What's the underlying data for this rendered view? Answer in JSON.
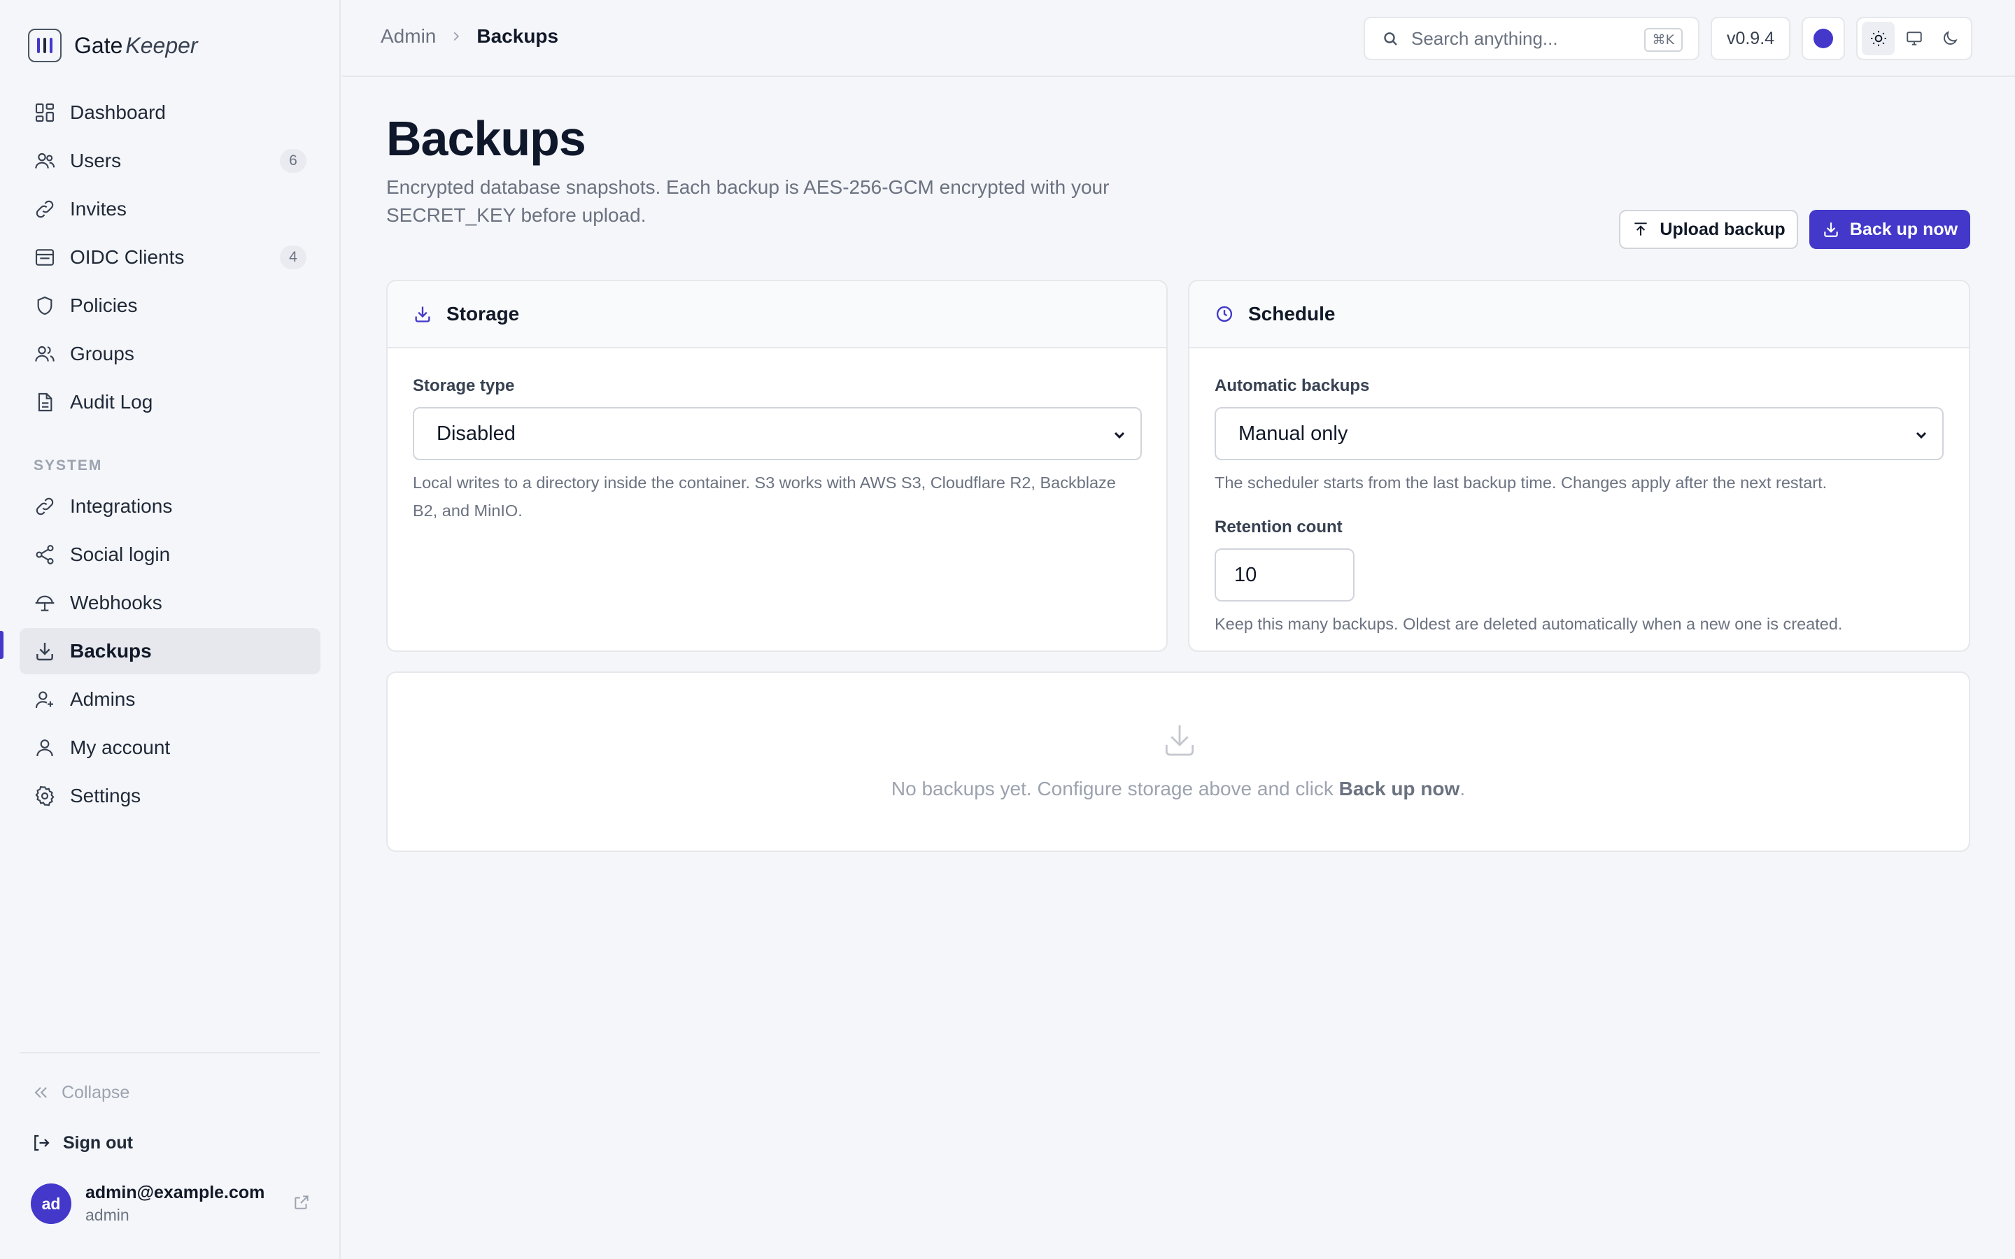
{
  "app": {
    "name_a": "Gate",
    "name_b": "Keeper"
  },
  "sidebar": {
    "items": [
      {
        "label": "Dashboard",
        "icon": "dashboard-icon"
      },
      {
        "label": "Users",
        "icon": "users-icon",
        "count": "6"
      },
      {
        "label": "Invites",
        "icon": "link-icon"
      },
      {
        "label": "OIDC Clients",
        "icon": "inbox-icon",
        "count": "4"
      },
      {
        "label": "Policies",
        "icon": "shield-icon"
      },
      {
        "label": "Groups",
        "icon": "groups-icon"
      },
      {
        "label": "Audit Log",
        "icon": "document-icon"
      }
    ],
    "section_label": "SYSTEM",
    "system_items": [
      {
        "label": "Integrations",
        "icon": "link-icon"
      },
      {
        "label": "Social login",
        "icon": "share-icon"
      },
      {
        "label": "Webhooks",
        "icon": "webhook-icon"
      },
      {
        "label": "Backups",
        "icon": "download-icon",
        "active": true
      },
      {
        "label": "Admins",
        "icon": "admin-icon"
      },
      {
        "label": "My account",
        "icon": "user-icon"
      },
      {
        "label": "Settings",
        "icon": "gear-icon"
      }
    ],
    "collapse_label": "Collapse",
    "signout_label": "Sign out",
    "user": {
      "initials": "ad",
      "email": "admin@example.com",
      "role": "admin"
    }
  },
  "topbar": {
    "breadcrumb": [
      "Admin",
      "Backups"
    ],
    "search_placeholder": "Search anything...",
    "search_shortcut": "⌘K",
    "version": "v0.9.4",
    "accent_color": "#4338ca",
    "theme_options": [
      "light",
      "system",
      "dark"
    ],
    "theme_selected": "light"
  },
  "main": {
    "title": "Backups",
    "description": "Encrypted database snapshots. Each backup is AES-256-GCM encrypted with your SECRET_KEY before upload.",
    "upload_button": "Upload backup",
    "backup_button": "Back up now",
    "storage": {
      "title": "Storage",
      "type_label": "Storage type",
      "type_value": "Disabled",
      "type_help": "Local writes to a directory inside the container. S3 works with AWS S3, Cloudflare R2, Backblaze B2, and MinIO."
    },
    "schedule": {
      "title": "Schedule",
      "auto_label": "Automatic backups",
      "auto_value": "Manual only",
      "auto_help": "The scheduler starts from the last backup time. Changes apply after the next restart.",
      "retention_label": "Retention count",
      "retention_value": "10",
      "retention_help": "Keep this many backups. Oldest are deleted automatically when a new one is created."
    },
    "empty": {
      "text_before": "No backups yet. Configure storage above and click ",
      "text_strong": "Back up now",
      "text_after": "."
    }
  }
}
